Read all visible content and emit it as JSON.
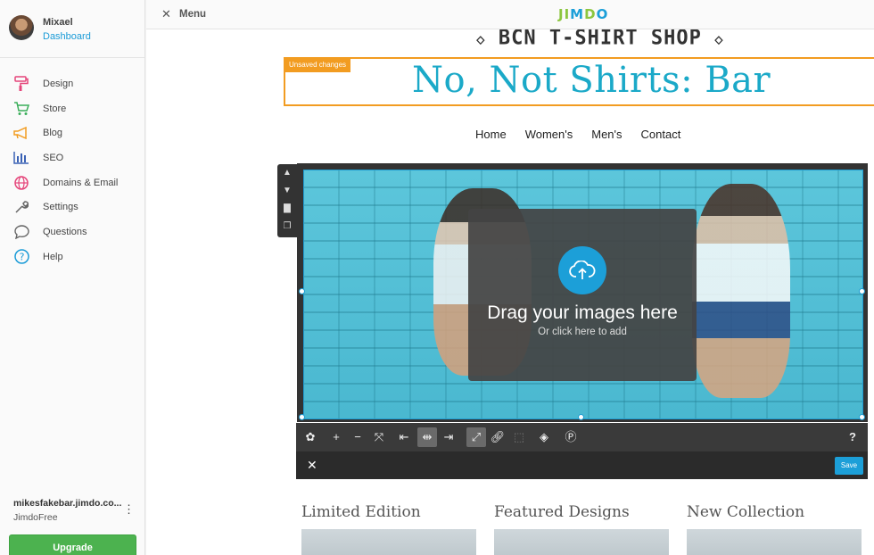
{
  "sidebar": {
    "user_name": "Mixael",
    "dashboard_link": "Dashboard",
    "items": [
      {
        "label": "Design",
        "icon": "paint-roller-icon",
        "color": "#e5457a"
      },
      {
        "label": "Store",
        "icon": "cart-icon",
        "color": "#3aae5a"
      },
      {
        "label": "Blog",
        "icon": "megaphone-icon",
        "color": "#f29c21"
      },
      {
        "label": "SEO",
        "icon": "bar-chart-icon",
        "color": "#3a62b5"
      },
      {
        "label": "Domains & Email",
        "icon": "globe-icon",
        "color": "#e5457a"
      },
      {
        "label": "Settings",
        "icon": "wrench-icon",
        "color": "#666666"
      },
      {
        "label": "Questions",
        "icon": "chat-bubble-icon",
        "color": "#666666"
      },
      {
        "label": "Help",
        "icon": "question-circle-icon",
        "color": "#1a9bd7"
      }
    ],
    "site_url": "mikesfakebar.jimdo.co...",
    "site_plan": "JimdoFree",
    "upgrade_label": "Upgrade"
  },
  "topbar": {
    "menu_label": "Menu",
    "logo_text": "JIMDO"
  },
  "site": {
    "shop_title": "BCN T-SHIRT SHOP",
    "unsaved_badge": "Unsaved changes",
    "big_title": "No, Not Shirts: Bar",
    "nav": [
      "Home",
      "Women's",
      "Men's",
      "Contact"
    ]
  },
  "image_block": {
    "drag_text": "Drag your images here",
    "click_text": "Or click here to add",
    "help_label": "?",
    "save_label": "Save"
  },
  "sections": [
    "Limited Edition",
    "Featured Designs",
    "New Collection"
  ],
  "colors": {
    "accent": "#1c9fd8",
    "unsaved": "#f29c21",
    "upgrade": "#4cb24f",
    "title": "#1ba9c8"
  }
}
